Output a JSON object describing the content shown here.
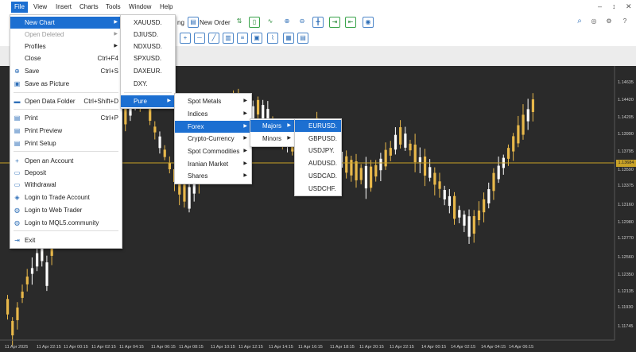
{
  "menubar": {
    "items": [
      "File",
      "View",
      "Insert",
      "Charts",
      "Tools",
      "Window",
      "Help"
    ],
    "window_controls": [
      "–",
      "↕",
      "✕"
    ]
  },
  "toolbar": {
    "trading_label": "ng",
    "new_order_label": "New Order"
  },
  "file_menu": {
    "items": [
      {
        "label": "New Chart",
        "shortcut": "",
        "submenu": true,
        "highlighted": true,
        "disabled": false,
        "icon": ""
      },
      {
        "label": "Open Deleted",
        "shortcut": "",
        "submenu": true,
        "disabled": true,
        "icon": ""
      },
      {
        "label": "Profiles",
        "shortcut": "",
        "submenu": true,
        "disabled": false,
        "icon": ""
      },
      {
        "label": "Close",
        "shortcut": "Ctrl+F4",
        "submenu": false,
        "disabled": false,
        "icon": ""
      },
      {
        "label": "Save",
        "shortcut": "Ctrl+S",
        "submenu": false,
        "disabled": false,
        "icon": "save-icon"
      },
      {
        "label": "Save as Picture",
        "shortcut": "",
        "submenu": false,
        "disabled": false,
        "icon": "picture-icon"
      },
      {
        "label": "Open Data Folder",
        "shortcut": "Ctrl+Shift+D",
        "submenu": false,
        "disabled": false,
        "icon": "folder-icon"
      },
      {
        "label": "Print",
        "shortcut": "Ctrl+P",
        "submenu": false,
        "disabled": false,
        "icon": "print-icon"
      },
      {
        "label": "Print Preview",
        "shortcut": "",
        "submenu": false,
        "disabled": false,
        "icon": "print-preview-icon"
      },
      {
        "label": "Print Setup",
        "shortcut": "",
        "submenu": false,
        "disabled": false,
        "icon": "print-setup-icon"
      },
      {
        "label": "Open an Account",
        "shortcut": "",
        "submenu": false,
        "disabled": false,
        "icon": "plus-icon"
      },
      {
        "label": "Deposit",
        "shortcut": "",
        "submenu": false,
        "disabled": false,
        "icon": "deposit-icon"
      },
      {
        "label": "Withdrawal",
        "shortcut": "",
        "submenu": false,
        "disabled": false,
        "icon": "withdrawal-icon"
      },
      {
        "label": "Login to Trade Account",
        "shortcut": "",
        "submenu": false,
        "disabled": false,
        "icon": "login-icon"
      },
      {
        "label": "Login to Web Trader",
        "shortcut": "",
        "submenu": false,
        "disabled": false,
        "icon": "globe-icon"
      },
      {
        "label": "Login to MQL5.community",
        "shortcut": "",
        "submenu": false,
        "disabled": false,
        "icon": "mql5-icon"
      },
      {
        "label": "Exit",
        "shortcut": "",
        "submenu": false,
        "disabled": false,
        "icon": "exit-icon"
      }
    ]
  },
  "new_chart_menu": {
    "items": [
      "XAUUSD.",
      "DJIUSD.",
      "NDXUSD.",
      "SPXUSD.",
      "DAXEUR.",
      "DXY.",
      "Pure"
    ],
    "highlighted": "Pure"
  },
  "pure_menu": {
    "items": [
      "Spot Metals",
      "Indices",
      "Forex",
      "Crypto-Currency",
      "Spot Commodities",
      "Iranian Market",
      "Shares"
    ],
    "highlighted": "Forex"
  },
  "forex_menu": {
    "items": [
      "Majors",
      "Minors"
    ],
    "highlighted": "Majors"
  },
  "majors_menu": {
    "items": [
      "EURUSD.",
      "GBPUSD.",
      "USDJPY.",
      "AUDUSD.",
      "USDCAD.",
      "USDCHF."
    ],
    "highlighted": "EURUSD."
  },
  "chart": {
    "price_labels": [
      "1.14635",
      "1.14420",
      "1.14205",
      "1.13990",
      "1.13795",
      "1.13590",
      "1.13375",
      "1.13160",
      "1.12980",
      "1.12770",
      "1.12560",
      "1.12350",
      "1.12135",
      "1.11930",
      "1.11745"
    ],
    "current_price": "1.13684",
    "time_labels": [
      "11 Apr 2025",
      "11 Apr 22:15",
      "11 Apr 00:15",
      "11 Apr 02:15",
      "11 Apr 04:15",
      "11 Apr 06:15",
      "11 Apr 08:15",
      "11 Apr 10:15",
      "11 Apr 12:15",
      "11 Apr 14:15",
      "11 Apr 16:15",
      "11 Apr 18:15",
      "11 Apr 20:15",
      "11 Apr 22:15",
      "14 Apr 00:15",
      "14 Apr 02:15",
      "14 Apr 04:15",
      "14 Apr 06:15"
    ],
    "colors": {
      "background": "#2a2a2a",
      "bull": "#e8b84a",
      "bear": "#ffffff",
      "price_line": "#c9a227",
      "accent": "#1c6fd1"
    }
  }
}
